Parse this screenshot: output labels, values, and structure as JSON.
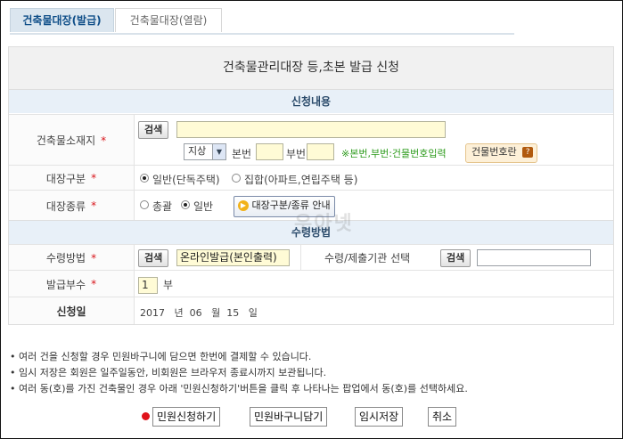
{
  "tabs": {
    "issue": "건축물대장(발급)",
    "view": "건축물대장(열람)"
  },
  "title": "건축물관리대장 등,초본 발급 신청",
  "sections": {
    "request": "신청내용",
    "receive": "수령방법"
  },
  "location": {
    "label": "건축물소재지",
    "required": "*",
    "search": "검색",
    "address_value": "",
    "land_type": "지상",
    "bonbeon_label": "본번",
    "bubeon_label": "부번",
    "hint": "※본번,부번:건물번호입력",
    "building_search": "건물번호란"
  },
  "register_type": {
    "label": "대장구분",
    "required": "*",
    "opt1": "일반(단독주택)",
    "opt2": "집합(아파트,연립주택 등)"
  },
  "register_kind": {
    "label": "대장종류",
    "required": "*",
    "opt1": "총괄",
    "opt2": "일반",
    "guide": "대장구분/종류 안내"
  },
  "receive": {
    "label": "수령방법",
    "required": "*",
    "search": "검색",
    "value": "온라인발급(본인출력)",
    "agency_label": "수령/제출기관 선택",
    "agency_search": "검색",
    "agency_value": ""
  },
  "copies": {
    "label": "발급부수",
    "required": "*",
    "value": "1",
    "unit": "부"
  },
  "date": {
    "label": "신청일",
    "year": "2017",
    "year_unit": "년",
    "month": "06",
    "month_unit": "월",
    "day": "15",
    "day_unit": "일"
  },
  "notes": [
    "• 여러 건을 신청할 경우 민원바구니에 담으면 한번에 결제할 수 있습니다.",
    "• 임시 저장은 회원은 일주일동안, 비회원은 브라우저 종료시까지 보관됩니다.",
    "• 여러 동(호)를 가진 건축물인 경우 아래 '민원신청하기'버튼을 클릭 후 나타나는 팝업에서 동(호)를 선택하세요."
  ],
  "buttons": {
    "apply": "민원신청하기",
    "basket": "민원바구니담기",
    "temp_save": "임시저장",
    "cancel": "취소"
  },
  "watermark": "우아넷"
}
